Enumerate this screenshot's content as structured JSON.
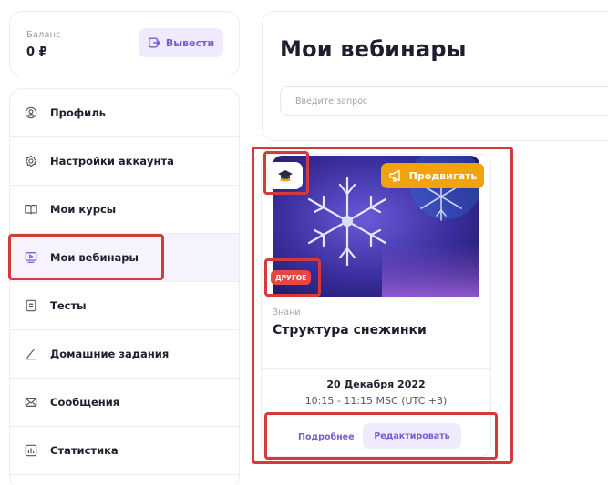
{
  "balance": {
    "label": "Баланс",
    "amount": "0 ₽",
    "withdraw_label": "Вывести"
  },
  "sidebar": {
    "items": [
      {
        "label": "Профиль",
        "icon": "user-circle-icon",
        "active": false
      },
      {
        "label": "Настройки аккаунта",
        "icon": "gear-icon",
        "active": false
      },
      {
        "label": "Мои курсы",
        "icon": "book-open-icon",
        "active": false
      },
      {
        "label": "Мои вебинары",
        "icon": "video-screen-icon",
        "active": true
      },
      {
        "label": "Тесты",
        "icon": "document-icon",
        "active": false
      },
      {
        "label": "Домашние задания",
        "icon": "pen-icon",
        "active": false
      },
      {
        "label": "Сообщения",
        "icon": "envelope-icon",
        "active": false
      },
      {
        "label": "Статистика",
        "icon": "bar-chart-icon",
        "active": false
      }
    ]
  },
  "main": {
    "title": "Мои вебинары",
    "search": {
      "placeholder": "Введите запрос",
      "value": ""
    }
  },
  "webinar": {
    "promote_label": "Продвигать",
    "category": "ДРУГОЕ",
    "author": "Знани",
    "title": "Структура снежинки",
    "date": "20 Декабря 2022",
    "time": "10:15 - 11:15  MSC (UTC +3)",
    "details_label": "Подробнее",
    "edit_label": "Редактировать"
  },
  "colors": {
    "accent": "#7b5cd6",
    "accent_bg": "#efeafc",
    "promote": "#f2a20c",
    "category_tag": "#e9463f",
    "highlight": "#d43a3a"
  }
}
